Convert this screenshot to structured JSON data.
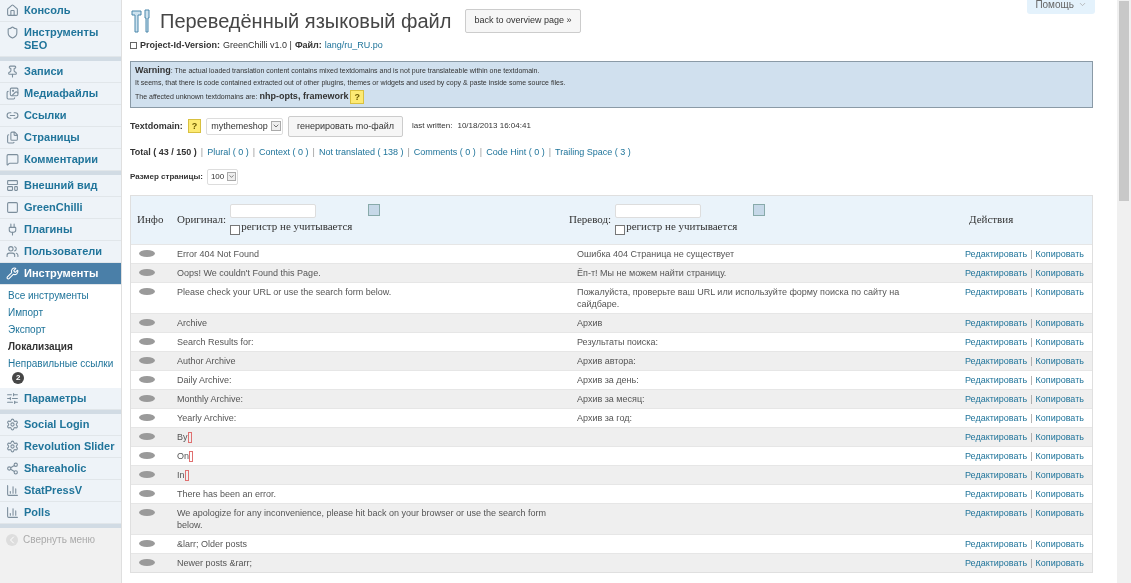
{
  "sidebar": {
    "groups": [
      [
        {
          "label": "Консоль",
          "selected": false
        },
        {
          "label": "Инструменты SEO",
          "selected": false
        }
      ],
      [
        {
          "label": "Записи",
          "selected": false
        },
        {
          "label": "Медиафайлы",
          "selected": false
        },
        {
          "label": "Ссылки",
          "selected": false
        },
        {
          "label": "Страницы",
          "selected": false
        },
        {
          "label": "Комментарии",
          "selected": false
        }
      ],
      [
        {
          "label": "Внешний вид",
          "selected": false
        },
        {
          "label": "GreenChilli",
          "selected": false
        },
        {
          "label": "Плагины",
          "selected": false
        },
        {
          "label": "Пользователи",
          "selected": false
        },
        {
          "label": "Инструменты",
          "selected": true,
          "submenu": [
            {
              "label": "Все инструменты",
              "selected": false
            },
            {
              "label": "Импорт",
              "selected": false
            },
            {
              "label": "Экспорт",
              "selected": false
            },
            {
              "label": "Локализация",
              "selected": true
            },
            {
              "label": "Неправильные ссылки",
              "selected": false,
              "badge": "2"
            }
          ]
        },
        {
          "label": "Параметры",
          "selected": false
        }
      ],
      [
        {
          "label": "Social Login",
          "selected": false
        },
        {
          "label": "Revolution Slider",
          "selected": false
        },
        {
          "label": "Shareaholic",
          "selected": false
        },
        {
          "label": "StatPressV",
          "selected": false
        },
        {
          "label": "Polls",
          "selected": false
        }
      ]
    ],
    "collapse": "Свернуть меню"
  },
  "help_button": "Помощь",
  "title": "Переведённый языковый файл",
  "back_button": "back to overview page »",
  "project": {
    "label": "Project-Id-Version:",
    "value": "GreenChilli v1.0 |",
    "file_label": "Файл:",
    "file": "lang/ru_RU.po"
  },
  "warning": {
    "lines": [
      "**Warning**: The actual loaded translation content contains mixed textdomains and is not pure translateable within one textdomain.",
      "It seems, that there is code contained extracted out of other plugins, themes or widgets and used by copy & paste inside some source files.",
      "The affected unknown textdomains are: **nhp-opts, framework**"
    ],
    "help": "?"
  },
  "textdomain": {
    "label": "Textdomain:",
    "help": "?",
    "value": "mythemeshop",
    "button": "генерировать mo-файл",
    "last_written_label": "last written:",
    "last_written": "10/18/2013 16:04:41"
  },
  "filters": [
    {
      "label": "Total ( 43 / 150 )",
      "selected": true
    },
    {
      "sep": "|",
      "label": "Plural ( 0 )",
      "selected": false
    },
    {
      "sep": "|",
      "label": "Context ( 0 )",
      "selected": false
    },
    {
      "sep": "|",
      "label": "Not translated ( 138 )",
      "selected": false
    },
    {
      "sep": "|",
      "label": "Comments ( 0 )",
      "selected": false
    },
    {
      "sep": "|",
      "label": "Code Hint ( 0 )",
      "selected": false
    },
    {
      "sep": "|",
      "label": "Trailing Space ( 3 )",
      "selected": false
    }
  ],
  "page_size": {
    "label": "Размер страницы:",
    "value": "100"
  },
  "table": {
    "info_column": "Инфо",
    "search_columns": [
      {
        "header": "Оригинал:",
        "case_label": "регистр не учитывается",
        "checked": false
      },
      {
        "header": "Перевод:",
        "case_label": "регистр не учитывается",
        "checked": false
      }
    ],
    "actions_column": "Действия",
    "rows": [
      {
        "original": "Error 404 Not Found",
        "translation": "Ошибка 404 Страница не существует",
        "trailing_space": false,
        "edit": "Редактировать",
        "sep": "|",
        "copy": "Копировать"
      },
      {
        "original": "Oops! We couldn't Found this Page.",
        "translation": "Ёп-т! Мы не можем найти страницу.",
        "trailing_space": false,
        "edit": "Редактировать",
        "sep": "|",
        "copy": "Копировать"
      },
      {
        "original": "Please check your URL or use the search form below.",
        "translation": "Пожалуйста, проверьте ваш URL или используйте форму поиска по сайту на сайдбаре.",
        "trailing_space": false,
        "edit": "Редактировать",
        "sep": "|",
        "copy": "Копировать"
      },
      {
        "original": "Archive",
        "translation": "Архив",
        "trailing_space": false,
        "edit": "Редактировать",
        "sep": "|",
        "copy": "Копировать"
      },
      {
        "original": "Search Results for:",
        "translation": "Результаты поиска:",
        "trailing_space": false,
        "edit": "Редактировать",
        "sep": "|",
        "copy": "Копировать"
      },
      {
        "original": "Author Archive",
        "translation": "Архив автора:",
        "trailing_space": false,
        "edit": "Редактировать",
        "sep": "|",
        "copy": "Копировать"
      },
      {
        "original": "Daily Archive:",
        "translation": "Архив за день:",
        "trailing_space": false,
        "edit": "Редактировать",
        "sep": "|",
        "copy": "Копировать"
      },
      {
        "original": "Monthly Archive:",
        "translation": "Архив за месяц:",
        "trailing_space": false,
        "edit": "Редактировать",
        "sep": "|",
        "copy": "Копировать"
      },
      {
        "original": "Yearly Archive:",
        "translation": "Архив за год:",
        "trailing_space": false,
        "edit": "Редактировать",
        "sep": "|",
        "copy": "Копировать"
      },
      {
        "original": "By",
        "trailing_space": true,
        "edit": "Редактировать",
        "sep": "|",
        "copy": "Копировать"
      },
      {
        "original": "On",
        "trailing_space": true,
        "edit": "Редактировать",
        "sep": "|",
        "copy": "Копировать"
      },
      {
        "original": "In",
        "trailing_space": true,
        "edit": "Редактировать",
        "sep": "|",
        "copy": "Копировать"
      },
      {
        "original": "There has been an error.",
        "trailing_space": false,
        "edit": "Редактировать",
        "sep": "|",
        "copy": "Копировать"
      },
      {
        "original": "We apologize for any inconvenience, please hit back on your browser or use the search form below.",
        "trailing_space": false,
        "edit": "Редактировать",
        "sep": "|",
        "copy": "Копировать"
      },
      {
        "original": "&larr; Older posts",
        "trailing_space": false,
        "edit": "Редактировать",
        "sep": "|",
        "copy": "Копировать"
      },
      {
        "original": "Newer posts &rarr;",
        "trailing_space": false,
        "edit": "Редактировать",
        "sep": "|",
        "copy": "Копировать"
      }
    ]
  }
}
